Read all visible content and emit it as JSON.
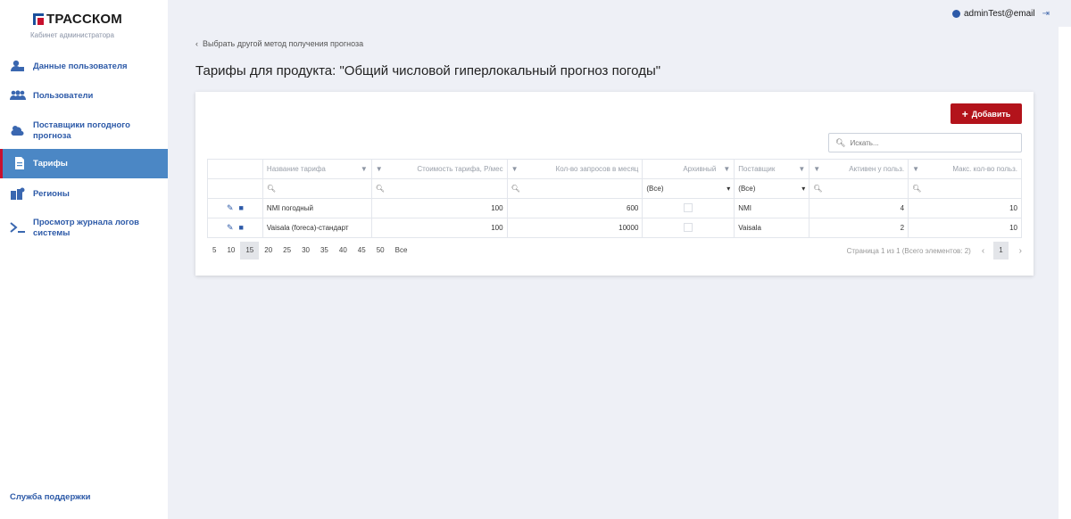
{
  "brand": {
    "name": "ТРАССКОМ",
    "subtitle": "Кабинет администратора"
  },
  "user": {
    "email": "adminTest@email"
  },
  "sidebar": {
    "items": [
      {
        "label": "Данные пользователя",
        "icon": "user-data-icon"
      },
      {
        "label": "Пользователи",
        "icon": "users-icon"
      },
      {
        "label": "Поставщики погодного прогноза",
        "icon": "weather-providers-icon"
      },
      {
        "label": "Тарифы",
        "icon": "tariffs-icon",
        "active": true
      },
      {
        "label": "Регионы",
        "icon": "regions-icon"
      },
      {
        "label": "Просмотр журнала логов системы",
        "icon": "terminal-icon"
      }
    ],
    "support": "Служба поддержки"
  },
  "main": {
    "back_link": "Выбрать другой метод получения прогноза",
    "title": "Тарифы для продукта: \"Общий числовой гиперлокальный прогноз погоды\"",
    "add_button": "Добавить",
    "search_placeholder": "Искать..."
  },
  "table": {
    "columns": [
      "Название тарифа",
      "Стоимость тарифа, Р/мес",
      "Кол-во запросов в месяц",
      "Архивный",
      "Поставщик",
      "Активен у польз.",
      "Макс. кол-во польз."
    ],
    "filter_all": "(Все)",
    "rows": [
      {
        "name": "NMI погодный",
        "price": "100",
        "requests": "600",
        "provider": "NMI",
        "active": "4",
        "max": "10"
      },
      {
        "name": "Vaisala (foreca)-стандарт",
        "price": "100",
        "requests": "10000",
        "provider": "Vaisala",
        "active": "2",
        "max": "10"
      }
    ]
  },
  "pager": {
    "sizes": [
      "5",
      "10",
      "15",
      "20",
      "25",
      "30",
      "35",
      "40",
      "45",
      "50",
      "Все"
    ],
    "current_size": "15",
    "info": "Страница 1 из 1 (Всего элементов: 2)",
    "page": "1"
  },
  "colors": {
    "accent": "#b3131b",
    "active_nav": "#4b87c5",
    "link": "#2d5aa8"
  }
}
